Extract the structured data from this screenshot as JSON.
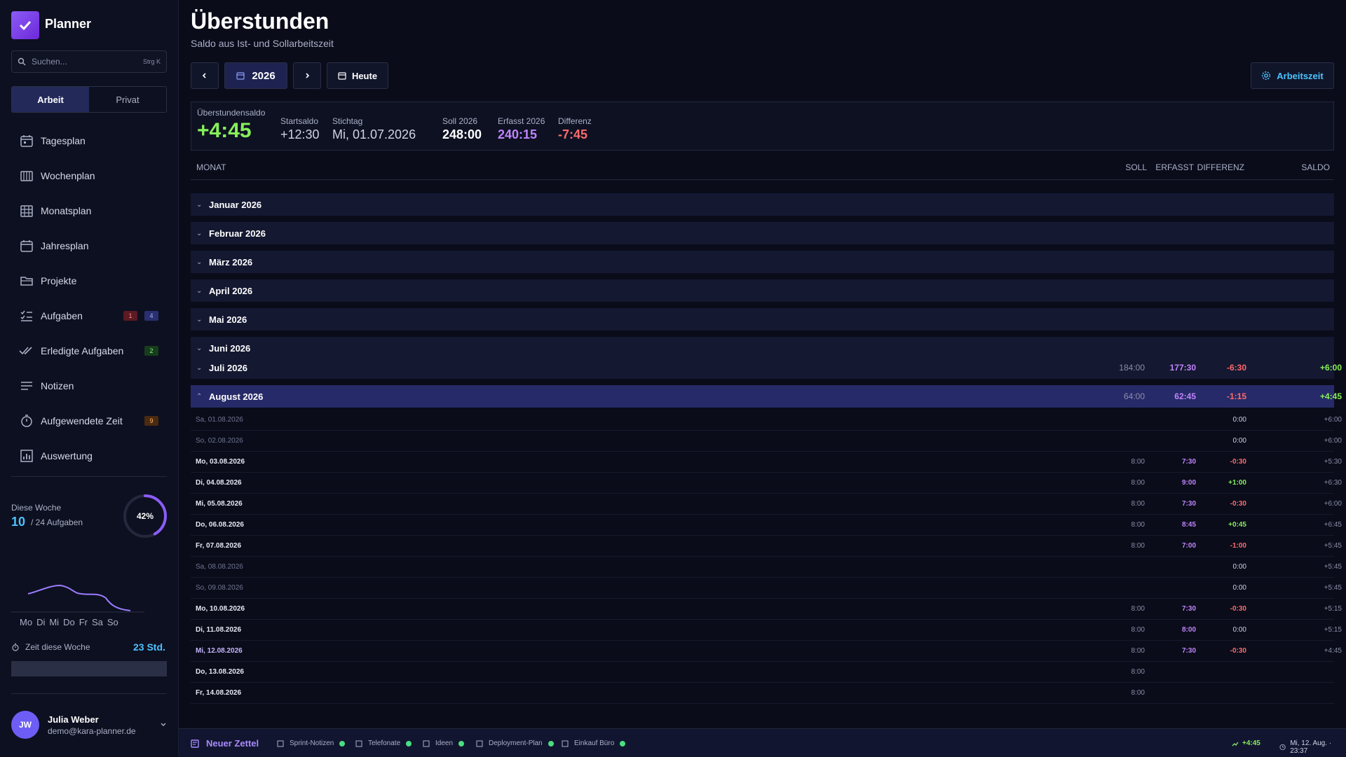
{
  "app": {
    "title": "Planner"
  },
  "search": {
    "placeholder": "Suchen...",
    "shortcut": "Strg K"
  },
  "segments": [
    "Arbeit",
    "Privat"
  ],
  "nav": [
    {
      "label": "Tagesplan",
      "icon": "calendar-day-icon"
    },
    {
      "label": "Wochenplan",
      "icon": "calendar-week-icon"
    },
    {
      "label": "Monatsplan",
      "icon": "calendar-month-icon"
    },
    {
      "label": "Jahresplan",
      "icon": "calendar-icon"
    },
    {
      "label": "Projekte",
      "icon": "folder-icon"
    },
    {
      "label": "Aufgaben",
      "icon": "task-list-icon",
      "badges": [
        "1",
        "4"
      ]
    },
    {
      "label": "Erledigte Aufgaben",
      "icon": "double-check-icon",
      "badges": [
        "2"
      ]
    },
    {
      "label": "Notizen",
      "icon": "notes-icon"
    },
    {
      "label": "Aufgewendete Zeit",
      "icon": "stopwatch-icon",
      "badges": [
        "9"
      ]
    },
    {
      "label": "Auswertung",
      "icon": "chart-icon"
    }
  ],
  "week": {
    "label": "Diese Woche",
    "count": "10",
    "of": "/ 24 Aufgaben",
    "percent": "42%",
    "progress": 0.42,
    "days": [
      "Mo",
      "Di",
      "Mi",
      "Do",
      "Fr",
      "Sa",
      "So"
    ],
    "time_label": "Zeit diese Woche",
    "time_value": "23 Std."
  },
  "user": {
    "initials": "JW",
    "name": "Julia Weber",
    "email": "demo@kara-planner.de"
  },
  "page": {
    "title": "Überstunden",
    "subtitle": "Saldo aus Ist- und Sollarbeitszeit",
    "year": "2026",
    "today": "Heute",
    "settings": "Arbeitszeit"
  },
  "summary": {
    "balance_label": "Überstundensaldo",
    "balance": "+4:45",
    "start_label": "Startsaldo",
    "start": "+12:30",
    "key_label": "Stichtag",
    "key": "Mi, 01.07.2026",
    "soll_label": "Soll 2026",
    "soll": "248:00",
    "erf_label": "Erfasst 2026",
    "erf": "240:15",
    "diff_label": "Differenz",
    "diff": "-7:45"
  },
  "columns": {
    "month": "MONAT",
    "soll": "SOLL",
    "erfasst": "ERFASST",
    "diff": "DIFFERENZ",
    "saldo": "SALDO"
  },
  "months": [
    {
      "name": "Januar 2026"
    },
    {
      "name": "Februar 2026"
    },
    {
      "name": "März 2026"
    },
    {
      "name": "April 2026"
    },
    {
      "name": "Mai 2026"
    },
    {
      "name": "Juni 2026"
    },
    {
      "name": "Juli 2026",
      "soll": "184:00",
      "erf": "177:30",
      "diff": "-6:30",
      "saldo": "+6:00"
    },
    {
      "name": "August 2026",
      "soll": "64:00",
      "erf": "62:45",
      "diff": "-1:15",
      "saldo": "+4:45"
    }
  ],
  "days": [
    {
      "name": "Sa, 01.08.2026",
      "soll": "",
      "erf": "",
      "diff": "0:00",
      "saldo": "+6:00",
      "weekend": true
    },
    {
      "name": "So, 02.08.2026",
      "soll": "",
      "erf": "",
      "diff": "0:00",
      "saldo": "+6:00",
      "weekend": true
    },
    {
      "name": "Mo, 03.08.2026",
      "soll": "8:00",
      "erf": "7:30",
      "diff": "-0:30",
      "saldo": "+5:30"
    },
    {
      "name": "Di, 04.08.2026",
      "soll": "8:00",
      "erf": "9:00",
      "diff": "+1:00",
      "saldo": "+6:30"
    },
    {
      "name": "Mi, 05.08.2026",
      "soll": "8:00",
      "erf": "7:30",
      "diff": "-0:30",
      "saldo": "+6:00"
    },
    {
      "name": "Do, 06.08.2026",
      "soll": "8:00",
      "erf": "8:45",
      "diff": "+0:45",
      "saldo": "+6:45"
    },
    {
      "name": "Fr, 07.08.2026",
      "soll": "8:00",
      "erf": "7:00",
      "diff": "-1:00",
      "saldo": "+5:45"
    },
    {
      "name": "Sa, 08.08.2026",
      "soll": "",
      "erf": "",
      "diff": "0:00",
      "saldo": "+5:45",
      "weekend": true
    },
    {
      "name": "So, 09.08.2026",
      "soll": "",
      "erf": "",
      "diff": "0:00",
      "saldo": "+5:45",
      "weekend": true
    },
    {
      "name": "Mo, 10.08.2026",
      "soll": "8:00",
      "erf": "7:30",
      "diff": "-0:30",
      "saldo": "+5:15"
    },
    {
      "name": "Di, 11.08.2026",
      "soll": "8:00",
      "erf": "8:00",
      "diff": "0:00",
      "saldo": "+5:15"
    },
    {
      "name": "Mi, 12.08.2026",
      "soll": "8:00",
      "erf": "7:30",
      "diff": "-0:30",
      "saldo": "+4:45",
      "today": true
    },
    {
      "name": "Do, 13.08.2026",
      "soll": "8:00",
      "erf": "",
      "diff": "",
      "saldo": ""
    },
    {
      "name": "Fr, 14.08.2026",
      "soll": "8:00",
      "erf": "",
      "diff": "",
      "saldo": ""
    }
  ],
  "bottom": {
    "new_note": "Neuer Zettel",
    "notes": [
      "Sprint-Notizen",
      "Telefonate",
      "Ideen",
      "Deployment-Plan",
      "Einkauf Büro"
    ],
    "saldo": "+4:45",
    "datetime": "Mi, 12. Aug. · 23:37"
  },
  "colors": {
    "accent": "#8b5cf6",
    "positive": "#86ef5a",
    "negative": "#ff6b6b",
    "info": "#4cc3ff"
  }
}
